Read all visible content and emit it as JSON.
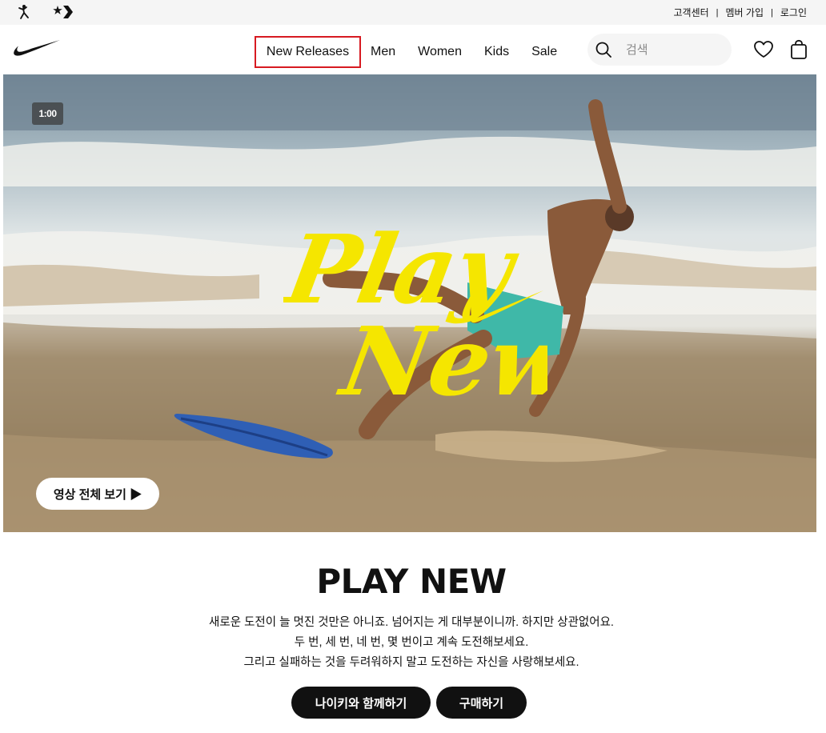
{
  "utility_bar": {
    "brand_icons": [
      "jordan-jumpman-icon",
      "converse-star-chevron-icon"
    ],
    "links": [
      "고객센터",
      "멤버 가입",
      "로그인"
    ],
    "separator": "|"
  },
  "nav": {
    "logo": "nike-swoosh-icon",
    "items": [
      "New Releases",
      "Men",
      "Women",
      "Kids",
      "Sale"
    ],
    "highlighted_item": "New Releases",
    "highlight_color": "#d71a21",
    "search": {
      "placeholder": "검색",
      "icon": "search-icon"
    },
    "icons": [
      "heart-icon",
      "shopping-bag-icon"
    ]
  },
  "hero": {
    "video_timer": "1:00",
    "logo_text_lines": [
      "Play",
      "New"
    ],
    "logo_color": "#f5e600",
    "watch_button": "영상 전체 보기 ▶"
  },
  "content": {
    "headline": "PLAY NEW",
    "description": [
      "새로운 도전이 늘 멋진 것만은 아니죠. 넘어지는 게 대부분이니까. 하지만 상관없어요.",
      "두 번, 세 번, 네 번, 몇 번이고 계속 도전해보세요.",
      "그리고 실패하는 것을 두려워하지 말고 도전하는 자신을 사랑해보세요."
    ],
    "buttons": [
      "나이키와 함께하기",
      "구매하기"
    ]
  }
}
